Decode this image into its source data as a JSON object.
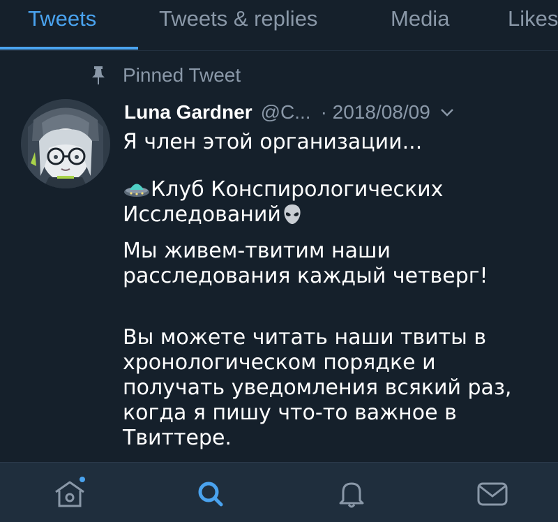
{
  "tabs": [
    {
      "label": "Tweets",
      "active": true
    },
    {
      "label": "Tweets & replies",
      "active": false
    },
    {
      "label": "Media",
      "active": false
    },
    {
      "label": "Likes",
      "active": false
    }
  ],
  "tweet": {
    "pinned_label": "Pinned Tweet",
    "author_name": "Luna Gardner",
    "author_handle": "@C...",
    "date": "· 2018/08/09",
    "line1": "Я член этой организации...",
    "club_part1": "Клуб Конспирологических",
    "club_part2": "Исследований",
    "para_live": "Мы живем-твитим наши расследования каждый четверг!",
    "para_follow": "Вы можете читать наши твиты в хронологическом порядке и получать уведомления всякий раз, когда я пишу что-то важное в Твиттере."
  },
  "bottom_nav": {
    "items": [
      "home-icon",
      "search-icon",
      "notifications-icon",
      "messages-icon"
    ]
  },
  "colors": {
    "background": "#15202b",
    "accent": "#4aa3ef",
    "secondary_text": "#8a98a8",
    "nav_background": "#1f2e3d"
  }
}
